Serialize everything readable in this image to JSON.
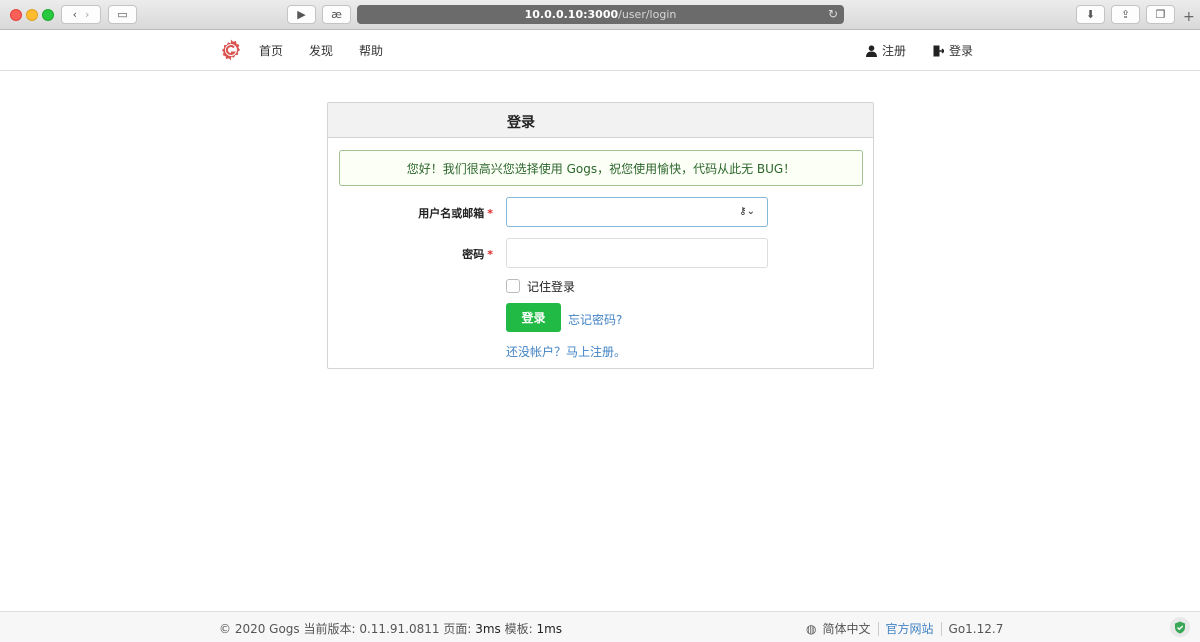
{
  "browser": {
    "url_host": "10.0.0.10:3000",
    "url_path": "/user/login",
    "reader_glyph": "æ"
  },
  "nav": {
    "links": [
      "首页",
      "发现",
      "帮助"
    ],
    "register": "注册",
    "login": "登录"
  },
  "card": {
    "title": "登录",
    "message": "您好！我们很高兴您选择使用 Gogs，祝您使用愉快，代码从此无 BUG！",
    "username_label": "用户名或邮箱",
    "password_label": "密码",
    "required_mark": "*",
    "remember": "记住登录",
    "submit": "登录",
    "forgot": "忘记密码?",
    "signup": "还没帐户？马上注册。"
  },
  "footer": {
    "copyright": "© 2020 Gogs 当前版本: 0.11.91.0811 页面: ",
    "page_time": "3ms",
    "template_label": " 模板: ",
    "template_time": "1ms",
    "language": "简体中文",
    "website": "官方网站",
    "go_version": "Go1.12.7"
  },
  "colors": {
    "accent": "#21ba45",
    "link": "#4183c4",
    "logo": "#d9534f"
  }
}
